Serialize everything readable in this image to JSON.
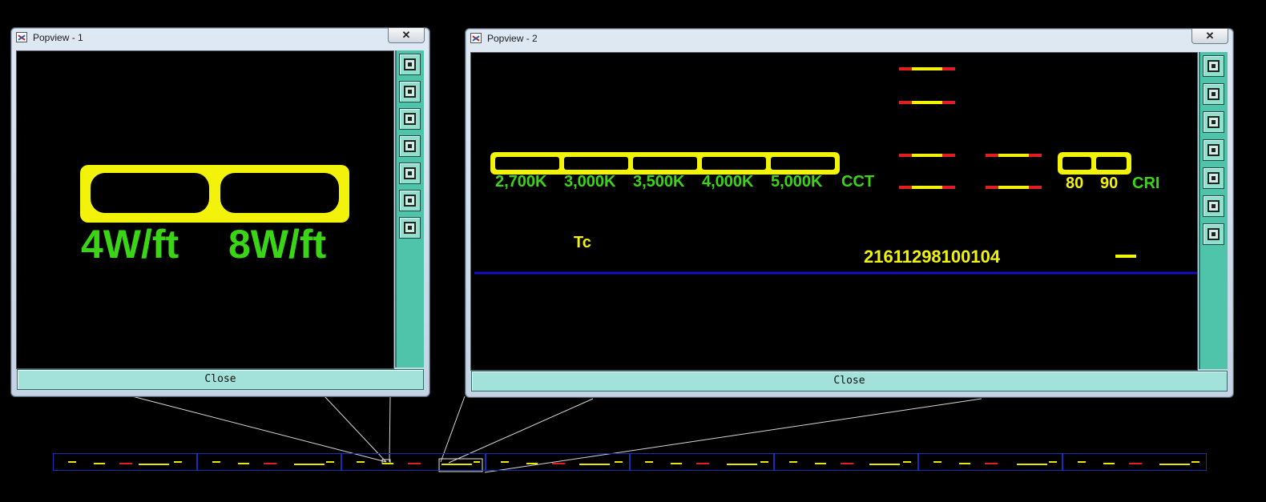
{
  "windows": {
    "popview1": {
      "title": "Popview - 1",
      "close_x": "✕",
      "close_button": "Close",
      "labels": {
        "w4": "4W/ft",
        "w8": "8W/ft"
      }
    },
    "popview2": {
      "title": "Popview - 2",
      "close_x": "✕",
      "close_button": "Close",
      "cct_values": [
        "2,700K",
        "3,000K",
        "3,500K",
        "4,000K",
        "5,000K"
      ],
      "cct_label": "CCT",
      "cri_values": [
        "80",
        "90"
      ],
      "cri_label": "CRI",
      "tc_label": "Tc",
      "part_number": "21611298100104"
    }
  },
  "toolbar_icons": [
    "zoom-window-icon",
    "zoom-up-icon",
    "zoom-down-icon",
    "pan-left-icon",
    "pan-right-icon",
    "zoom-extents-icon",
    "zoom-fit-icon"
  ],
  "colors": {
    "drawing_yellow": "#f2f20a",
    "drawing_green": "#3ad616",
    "drawing_red": "#e02020",
    "divider_blue": "#1010c0",
    "sidebar_teal": "#50c4aa"
  },
  "thumbnail_count": 8
}
